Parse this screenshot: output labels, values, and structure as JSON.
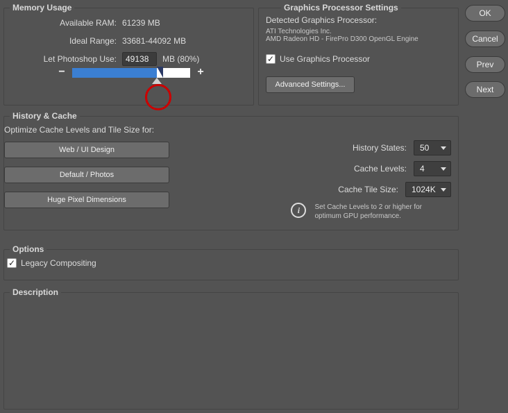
{
  "memory": {
    "title": "Memory Usage",
    "available_label": "Available RAM:",
    "available_value": "61239 MB",
    "ideal_label": "Ideal Range:",
    "ideal_value": "33681-44092 MB",
    "use_label": "Let Photoshop Use:",
    "use_value": "49138",
    "use_suffix": "MB (80%)",
    "slider_fill_pct": 72
  },
  "gpu": {
    "title": "Graphics Processor Settings",
    "detected_label": "Detected Graphics Processor:",
    "vendor": "ATI Technologies Inc.",
    "device": "AMD Radeon HD - FirePro D300 OpenGL Engine",
    "use_checkbox": "Use Graphics Processor",
    "advanced": "Advanced Settings..."
  },
  "cache": {
    "title": "History & Cache",
    "optimize_label": "Optimize Cache Levels and Tile Size for:",
    "btn_web": "Web / UI Design",
    "btn_default": "Default / Photos",
    "btn_huge": "Huge Pixel Dimensions",
    "history_states_label": "History States:",
    "history_states_value": "50",
    "cache_levels_label": "Cache Levels:",
    "cache_levels_value": "4",
    "cache_tile_label": "Cache Tile Size:",
    "cache_tile_value": "1024K",
    "hint_line1": "Set Cache Levels to 2 or higher for",
    "hint_line2": "optimum GPU performance."
  },
  "options": {
    "title": "Options",
    "legacy": "Legacy Compositing"
  },
  "description": {
    "title": "Description"
  },
  "side": {
    "ok": "OK",
    "cancel": "Cancel",
    "prev": "Prev",
    "next": "Next"
  }
}
